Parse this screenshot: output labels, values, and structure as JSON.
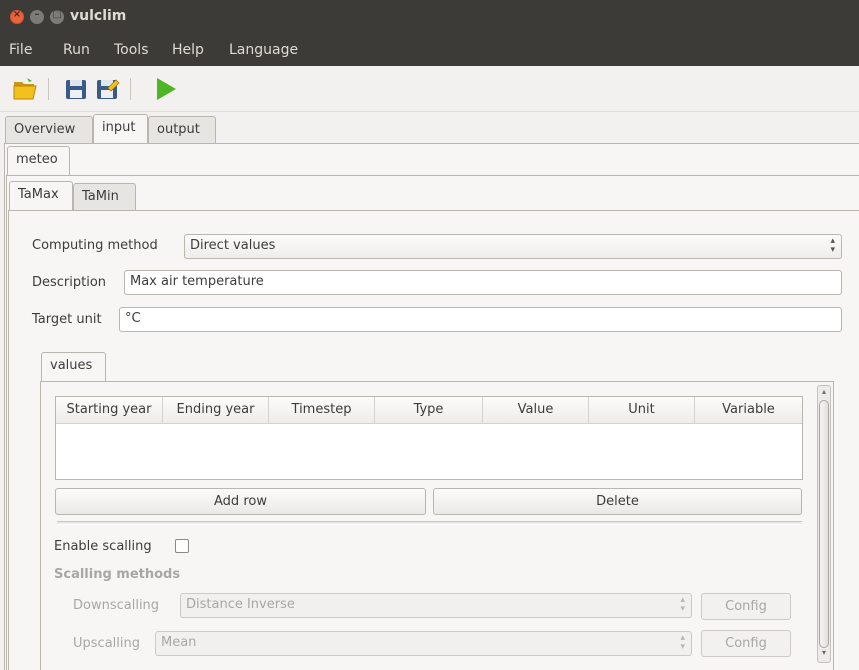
{
  "window": {
    "title": "vulclim"
  },
  "menu": {
    "file": "File",
    "run": "Run",
    "tools": "Tools",
    "help": "Help",
    "language": "Language"
  },
  "toolbar": {
    "open_icon": "folder-open-icon",
    "save_icon": "save-icon",
    "save_as_icon": "save-as-icon",
    "run_icon": "play-icon"
  },
  "tabs": {
    "overview": "Overview",
    "input": "input",
    "output": "output"
  },
  "subtabs": {
    "meteo": "meteo",
    "tamax": "TaMax",
    "tamin": "TaMin"
  },
  "form": {
    "computing_method_label": "Computing method",
    "computing_method_value": "Direct values",
    "description_label": "Description",
    "description_value": "Max air temperature",
    "target_unit_label": "Target unit",
    "target_unit_value": "°C"
  },
  "values_tab": "values",
  "table": {
    "headers": [
      "Starting year",
      "Ending year",
      "Timestep",
      "Type",
      "Value",
      "Unit",
      "Variable"
    ],
    "rows": []
  },
  "buttons": {
    "add_row": "Add row",
    "delete": "Delete"
  },
  "scaling": {
    "enable_label": "Enable scalling",
    "methods_title": "Scalling methods",
    "downscalling_label": "Downscalling",
    "downscalling_value": "Distance Inverse",
    "upscalling_label": "Upscalling",
    "upscalling_value": "Mean",
    "config_label": "Config"
  },
  "colors": {
    "titlebar": "#3c3b37",
    "close_button": "#e9643a",
    "run_green": "#4eb523"
  }
}
